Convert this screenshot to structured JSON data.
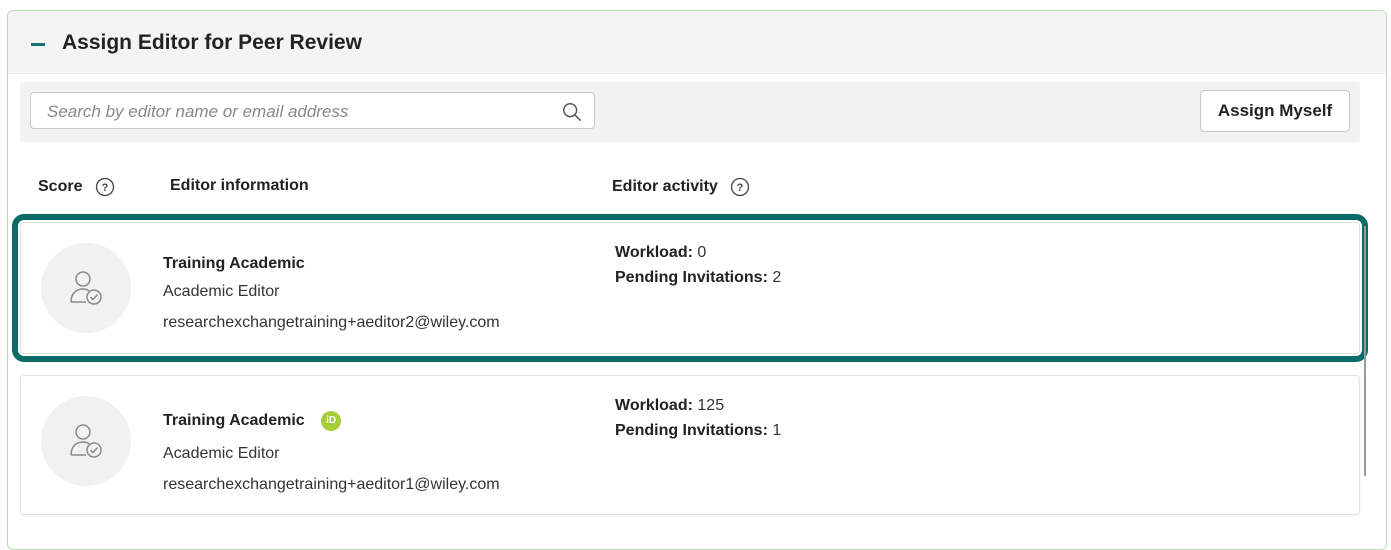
{
  "panel": {
    "title": "Assign Editor for Peer Review",
    "collapse_icon": "minus-icon"
  },
  "search": {
    "placeholder": "Search by editor name or email address",
    "value": ""
  },
  "buttons": {
    "assign_myself": "Assign Myself"
  },
  "columns": {
    "score": "Score",
    "editor_info": "Editor information",
    "editor_activity": "Editor activity"
  },
  "editors": [
    {
      "name": "Training Academic",
      "role": "Academic Editor",
      "email": "researchexchangetraining+aeditor2@wiley.com",
      "workload_label": "Workload:",
      "workload": "0",
      "pending_label": "Pending Invitations:",
      "pending": "2",
      "orcid": false
    },
    {
      "name": "Training Academic",
      "role": "Academic Editor",
      "email": "researchexchangetraining+aeditor1@wiley.com",
      "workload_label": "Workload:",
      "workload": "125",
      "pending_label": "Pending Invitations:",
      "pending": "1",
      "orcid": true,
      "orcid_text": "iD"
    }
  ],
  "colors": {
    "accent": "#0b6b66",
    "border": "#b9dcb3",
    "orcid": "#a6ce39"
  }
}
